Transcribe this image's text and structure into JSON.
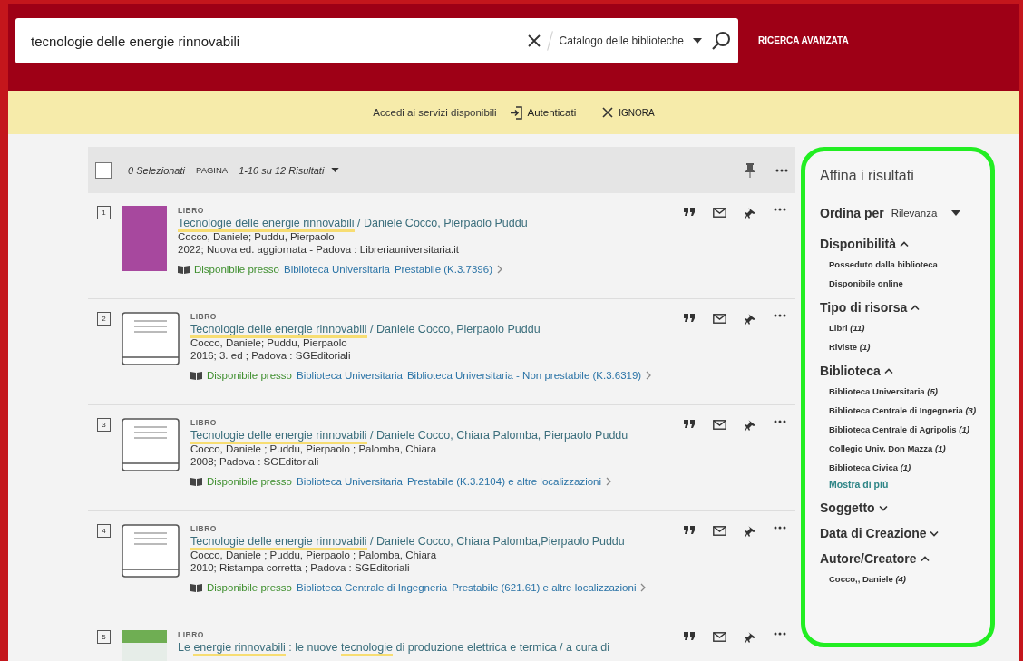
{
  "search": {
    "value": "tecnologie delle energie rinnovabili",
    "scope": "Catalogo delle biblioteche",
    "advanced": "RICERCA AVANZATA"
  },
  "banner": {
    "text": "Accedi ai servizi disponibili",
    "login": "Autenticati",
    "dismiss": "IGNORA"
  },
  "toolbar": {
    "selected_count": "0 Selezionati",
    "page_label": "PAGINA",
    "range": "1-10 su 12 Risultati",
    "checked": false
  },
  "results": [
    {
      "number": "1",
      "kind": "photo",
      "type": "LIBRO",
      "title": [
        {
          "text": "Tecnologie delle energie rinnovabili",
          "highlight": true
        },
        {
          "text": " / Daniele Cocco, Pierpaolo Puddu",
          "highlight": false
        }
      ],
      "authors": "Cocco, Daniele; Puddu, Pierpaolo",
      "edition": "2022; Nuova ed. aggiornata - Padova : Libreriauniversitaria.it",
      "availability": "Disponibile presso",
      "library": "Biblioteca Universitaria",
      "location": "Prestabile (K.3.7396)"
    },
    {
      "number": "2",
      "kind": "placeholder",
      "type": "LIBRO",
      "title": [
        {
          "text": "Tecnologie delle energie rinnovabili",
          "highlight": true
        },
        {
          "text": " / Daniele Cocco, Pierpaolo Puddu",
          "highlight": false
        }
      ],
      "authors": "Cocco, Daniele; Puddu, Pierpaolo",
      "edition": "2016; 3. ed ; Padova : SGEditoriali",
      "availability": "Disponibile presso",
      "library": "Biblioteca Universitaria",
      "location": "Biblioteca Universitaria - Non prestabile (K.3.6319)"
    },
    {
      "number": "3",
      "kind": "placeholder",
      "type": "LIBRO",
      "title": [
        {
          "text": "Tecnologie delle energie rinnovabili",
          "highlight": true
        },
        {
          "text": " / Daniele Cocco, Chiara Palomba, Pierpaolo Puddu",
          "highlight": false
        }
      ],
      "authors": "Cocco, Daniele ; Puddu, Pierpaolo ; Palomba, Chiara",
      "edition": "2008; Padova : SGEditoriali",
      "availability": "Disponibile presso",
      "library": "Biblioteca Universitaria",
      "location": "Prestabile (K.3.2104) e altre localizzazioni"
    },
    {
      "number": "4",
      "kind": "placeholder",
      "type": "LIBRO",
      "title": [
        {
          "text": "Tecnologie delle energie rinnovabili",
          "highlight": true
        },
        {
          "text": " / Daniele Cocco, Chiara Palomba,Pierpaolo Puddu",
          "highlight": false
        }
      ],
      "authors": "Cocco, Daniele ; Puddu, Pierpaolo ; Palomba, Chiara",
      "edition": "2010; Ristampa corretta ; Padova : SGEditoriali",
      "availability": "Disponibile presso",
      "library": "Biblioteca Centrale di Ingegneria",
      "location": "Prestabile (621.61) e altre localizzazioni"
    },
    {
      "number": "5",
      "kind": "photo",
      "type": "LIBRO",
      "title": [
        {
          "text": "Le ",
          "highlight": false
        },
        {
          "text": "energie rinnovabili",
          "highlight": true
        },
        {
          "text": " : le nuove ",
          "highlight": false
        },
        {
          "text": "tecnologie",
          "highlight": true
        },
        {
          "text": " di produzione elettrica e termica / a cura di",
          "highlight": false
        }
      ]
    }
  ],
  "refine": {
    "title": "Affina i risultati",
    "sort_label": "Ordina per",
    "sort_value": "Rilevanza",
    "sections": [
      {
        "title": "Disponibilità",
        "expanded": true,
        "items": [
          "Posseduto dalla biblioteca",
          "Disponibile online"
        ]
      },
      {
        "title": "Tipo di risorsa",
        "expanded": true,
        "items": [
          "Libri *(11)*",
          "Riviste *(1)*"
        ]
      },
      {
        "title": "Biblioteca",
        "expanded": true,
        "items": [
          "Biblioteca Universitaria *(5)*",
          "Biblioteca Centrale di Ingegneria *(3)*",
          "Biblioteca Centrale di Agripolis *(1)*",
          "Collegio Univ. Don Mazza *(1)*",
          "Biblioteca Civica *(1)*"
        ],
        "more": "Mostra di più"
      },
      {
        "title": "Soggetto",
        "expanded": false
      },
      {
        "title": "Data di Creazione",
        "expanded": false
      },
      {
        "title": "Autore/Creatore",
        "expanded": true,
        "items": [
          "Cocco,, Daniele *(4)*"
        ]
      }
    ]
  }
}
